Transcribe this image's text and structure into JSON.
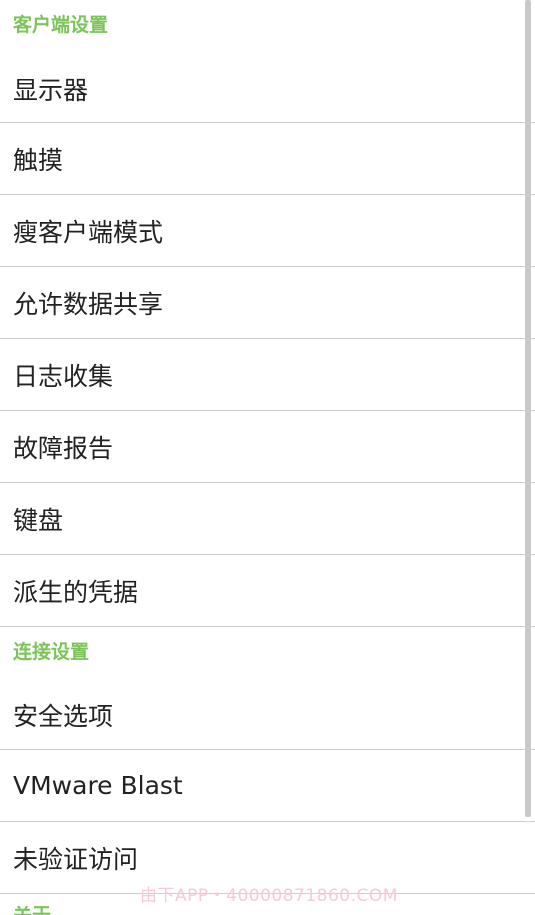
{
  "sections": [
    {
      "header": "客户端设置",
      "items": [
        "显示器",
        "触摸",
        "瘦客户端模式",
        "允许数据共享",
        "日志收集",
        "故障报告",
        "键盘",
        "派生的凭据"
      ]
    },
    {
      "header": "连接设置",
      "items": [
        "安全选项",
        "VMware Blast",
        "未验证访问"
      ]
    }
  ],
  "next_section_header_partial": "关于",
  "watermark_text": "由下APP・40000871860.COM",
  "colors": {
    "section_header": "#7cc45a",
    "item_text": "#222222",
    "divider": "#cfcfcf",
    "scrollbar": "#c9c9c9",
    "watermark": "#f6c9dc"
  }
}
